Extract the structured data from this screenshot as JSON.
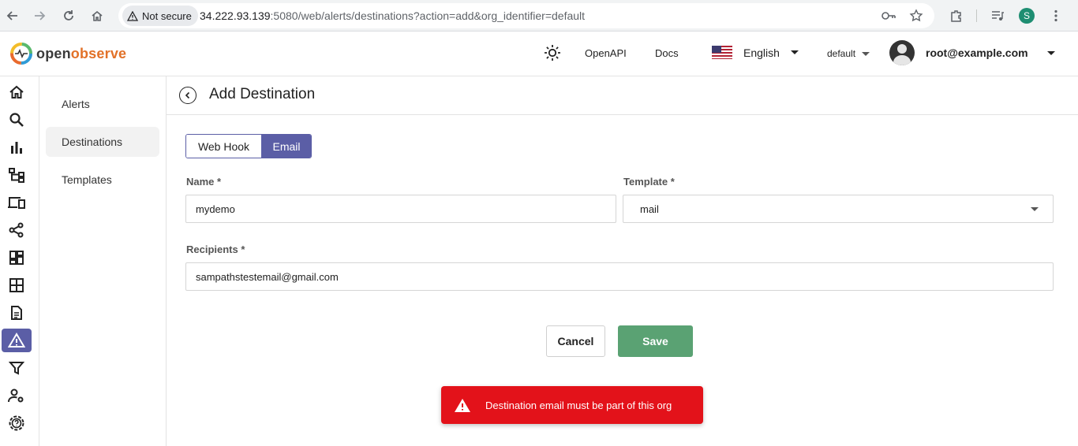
{
  "browser": {
    "security_label": "Not secure",
    "url_host": "34.222.93.139",
    "url_rest": ":5080/web/alerts/destinations?action=add&org_identifier=default",
    "profile_initial": "S"
  },
  "header": {
    "brand_open": "open",
    "brand_observe": "observe",
    "openapi": "OpenAPI",
    "docs": "Docs",
    "language": "English",
    "org": "default",
    "user": "root@example.com"
  },
  "rail": {
    "icons": [
      "home-icon",
      "search-icon",
      "bar-chart-icon",
      "hierarchy-icon",
      "devices-icon",
      "share-nodes-icon",
      "dashboard-icon",
      "grid-icon",
      "document-icon",
      "alert-triangle-icon",
      "filter-icon",
      "user-settings-icon",
      "settings-help-icon"
    ],
    "active": "alert-triangle-icon"
  },
  "submenu": {
    "items": [
      {
        "label": "Alerts"
      },
      {
        "label": "Destinations"
      },
      {
        "label": "Templates"
      }
    ]
  },
  "page": {
    "title": "Add Destination",
    "tabs": [
      "Web Hook",
      "Email"
    ],
    "active_tab": "Email",
    "name_label": "Name *",
    "name_value": "mydemo",
    "template_label": "Template *",
    "template_value": "mail",
    "recipients_label": "Recipients *",
    "recipients_value": "sampathstestemail@gmail.com",
    "cancel": "Cancel",
    "save": "Save"
  },
  "toast": {
    "message": "Destination email must be part of this org"
  },
  "colors": {
    "accent": "#5b5ea6",
    "save": "#5aa273",
    "error": "#e3121a"
  }
}
